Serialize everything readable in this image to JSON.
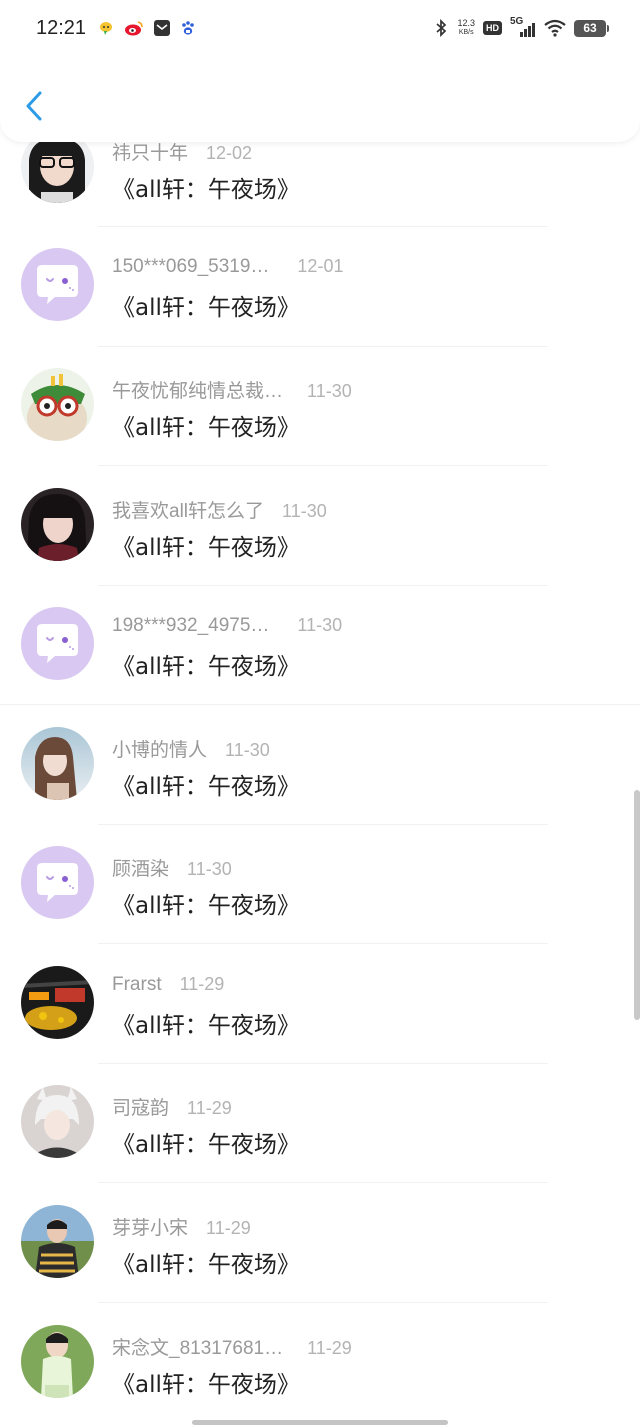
{
  "status_bar": {
    "time": "12:21",
    "net_speed_value": "12.3",
    "net_speed_unit": "KB/s",
    "hd": "HD",
    "network": "5G",
    "battery": "63"
  },
  "comments": [
    {
      "name": "祎只十年",
      "date": "12-02",
      "text": "《all轩：午夜场》",
      "avatar": "photo-glasses-girl"
    },
    {
      "name": "150***069_5319…",
      "date": "12-01",
      "text": "《all轩：午夜场》",
      "avatar": "default-chat-avatar"
    },
    {
      "name": "午夜忧郁纯情总裁…",
      "date": "11-30",
      "text": "《all轩：午夜场》",
      "avatar": "cartoon-green-frog"
    },
    {
      "name": "我喜欢all轩怎么了",
      "date": "11-30",
      "text": "《all轩：午夜场》",
      "avatar": "photo-dark-hair-girl"
    },
    {
      "name": "198***932_4975…",
      "date": "11-30",
      "text": "《all轩：午夜场》",
      "avatar": "default-chat-avatar"
    },
    {
      "name": "小博的情人",
      "date": "11-30",
      "text": "《all轩：午夜场》",
      "avatar": "photo-girl-sky"
    },
    {
      "name": "顾酒染",
      "date": "11-30",
      "text": "《all轩：午夜场》",
      "avatar": "default-chat-avatar"
    },
    {
      "name": "Frarst",
      "date": "11-29",
      "text": "《all轩：午夜场》",
      "avatar": "photo-stadium-lights"
    },
    {
      "name": "司寇韵",
      "date": "11-29",
      "text": "《all轩：午夜场》",
      "avatar": "anime-white-hair-boy"
    },
    {
      "name": "芽芽小宋",
      "date": "11-29",
      "text": "《all轩：午夜场》",
      "avatar": "photo-boy-lake"
    },
    {
      "name": "宋念文_81317681…",
      "date": "11-29",
      "text": "《all轩：午夜场》",
      "avatar": "photo-boy-grass"
    }
  ],
  "colors": {
    "back_arrow": "#2b9be8",
    "default_avatar_bg": "#d9c8f2",
    "name_text": "#999999",
    "comment_text": "#222222"
  }
}
